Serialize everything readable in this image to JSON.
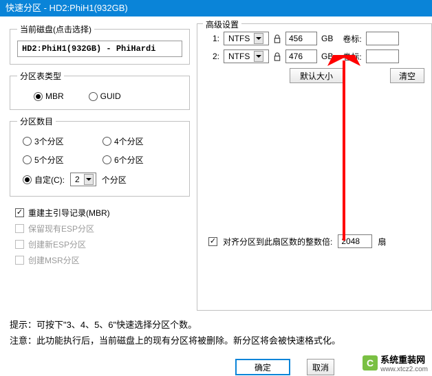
{
  "titlebar": "快速分区 - HD2:PhiH1(932GB)",
  "current_disk": {
    "legend": "当前磁盘(点击选择)",
    "value": "HD2:PhiH1(932GB) - PhiHardi"
  },
  "table_type": {
    "legend": "分区表类型",
    "mbr": "MBR",
    "guid": "GUID"
  },
  "partition_count": {
    "legend": "分区数目",
    "p3": "3个分区",
    "p4": "4个分区",
    "p5": "5个分区",
    "p6": "6个分区",
    "custom": "自定(C):",
    "custom_value": "2",
    "custom_suffix": "个分区"
  },
  "checkboxes": {
    "rebuild_mbr": "重建主引导记录(MBR)",
    "keep_esp": "保留现有ESP分区",
    "create_esp": "创建新ESP分区",
    "create_msr": "创建MSR分区"
  },
  "advanced": {
    "legend": "高级设置",
    "rows": [
      {
        "idx": "1:",
        "fs": "NTFS",
        "size": "456",
        "unit": "GB",
        "vol_label": "卷标:"
      },
      {
        "idx": "2:",
        "fs": "NTFS",
        "size": "476",
        "unit": "GB",
        "vol_label": "卷标:"
      }
    ],
    "default_size_btn": "默认大小",
    "clear_btn": "清空",
    "align_label": "对齐分区到此扇区数的整数倍:",
    "align_value": "2048",
    "align_unit": "扇"
  },
  "hints": {
    "line1": "提示：可按下\"3、4、5、6\"快速选择分区个数。",
    "line2": "注意：此功能执行后，当前磁盘上的现有分区将被删除。新分区将会被快速格式化。"
  },
  "buttons": {
    "ok": "确定",
    "cancel": "取消"
  },
  "watermark": {
    "text": "系统重装网",
    "url": "www.xtcz2.com"
  }
}
